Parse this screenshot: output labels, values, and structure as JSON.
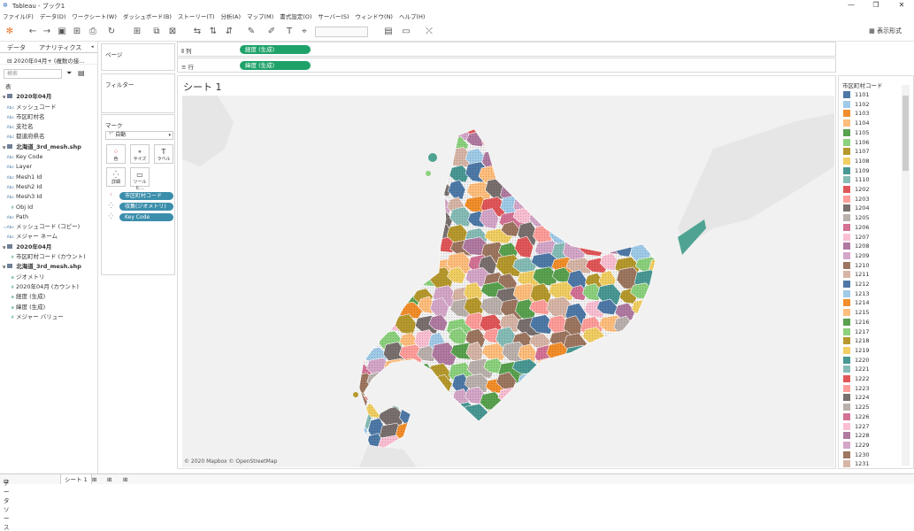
{
  "window": {
    "title": "Tableau - ブック1"
  },
  "menu": [
    "ファイル(F)",
    "データ(D)",
    "ワークシート(W)",
    "ダッシュボード(B)",
    "ストーリー(T)",
    "分析(A)",
    "マップ(M)",
    "書式設定(O)",
    "サーバー(S)",
    "ウィンドウ(N)",
    "ヘルプ(H)"
  ],
  "toolbar": {
    "show_me": "表示形式"
  },
  "datapane": {
    "tab_data": "データ",
    "tab_analytics": "アナリティクス",
    "source": "2020年04月+ (複数の接...",
    "search_placeholder": "検索",
    "section_table": "表",
    "fields": [
      {
        "type": "hdr",
        "name": "2020年04月"
      },
      {
        "type": "Abc",
        "name": "メッシュコード"
      },
      {
        "type": "Abc",
        "name": "市区町村名"
      },
      {
        "type": "Abc",
        "name": "支社名"
      },
      {
        "type": "Abc",
        "name": "都道府県名"
      },
      {
        "type": "hdr",
        "name": "北海道_3rd_mesh.shp"
      },
      {
        "type": "Abc",
        "name": "Key Code"
      },
      {
        "type": "Abc",
        "name": "Layer"
      },
      {
        "type": "Abc",
        "name": "Mesh1 Id"
      },
      {
        "type": "Abc",
        "name": "Mesh2 Id"
      },
      {
        "type": "Abc",
        "name": "Mesh3 Id"
      },
      {
        "type": "#",
        "name": "Obj Id"
      },
      {
        "type": "Abc",
        "name": "Path"
      },
      {
        "type": "=Abc",
        "name": "メッシュコード (コピー)"
      },
      {
        "type": "Abc",
        "name": "メジャー ネーム"
      },
      {
        "type": "hdr",
        "name": "2020年04月"
      },
      {
        "type": "#",
        "name": "市区町村コード (カウント)"
      },
      {
        "type": "hdr",
        "name": "北海道_3rd_mesh.shp"
      },
      {
        "type": "geo",
        "name": "ジオメトリ"
      },
      {
        "type": "#",
        "name": "2020年04月 (カウント)"
      },
      {
        "type": "geo",
        "name": "経度 (生成)"
      },
      {
        "type": "geo",
        "name": "緯度 (生成)"
      },
      {
        "type": "#",
        "name": "メジャー バリュー"
      }
    ]
  },
  "shelves": {
    "pages": "ページ",
    "filters": "フィルター",
    "marks": "マーク",
    "mark_type": "自動",
    "buttons": {
      "color": "色",
      "size": "サイズ",
      "label": "ラベル",
      "detail": "詳細",
      "tooltip": "ツールヒ..."
    },
    "mark_pills": [
      "市区町村コード",
      "収集(ジオメトリ)",
      "Key Code"
    ],
    "columns_label": "列",
    "rows_label": "行",
    "columns_pill": "経度 (生成)",
    "rows_pill": "緯度 (生成)"
  },
  "view": {
    "sheet_title": "シート 1",
    "credits": "© 2020 Mapbox © OpenStreetMap"
  },
  "legend": {
    "title": "市区町村コード",
    "items": [
      {
        "label": "1101",
        "color": "#4e79a7"
      },
      {
        "label": "1102",
        "color": "#a0cbe8"
      },
      {
        "label": "1103",
        "color": "#f28e2b"
      },
      {
        "label": "1104",
        "color": "#ffbe7d"
      },
      {
        "label": "1105",
        "color": "#59a14f"
      },
      {
        "label": "1106",
        "color": "#8cd17d"
      },
      {
        "label": "1107",
        "color": "#b6992d"
      },
      {
        "label": "1108",
        "color": "#f1ce63"
      },
      {
        "label": "1109",
        "color": "#499894"
      },
      {
        "label": "1110",
        "color": "#86bcb6"
      },
      {
        "label": "1202",
        "color": "#e15759"
      },
      {
        "label": "1203",
        "color": "#ff9d9a"
      },
      {
        "label": "1204",
        "color": "#79706e"
      },
      {
        "label": "1205",
        "color": "#bab0ac"
      },
      {
        "label": "1206",
        "color": "#d37295"
      },
      {
        "label": "1207",
        "color": "#fabfd2"
      },
      {
        "label": "1208",
        "color": "#b07aa1"
      },
      {
        "label": "1209",
        "color": "#d4a6c8"
      },
      {
        "label": "1210",
        "color": "#9d7660"
      },
      {
        "label": "1211",
        "color": "#d7b5a6"
      },
      {
        "label": "1212",
        "color": "#4e79a7"
      },
      {
        "label": "1213",
        "color": "#a0cbe8"
      },
      {
        "label": "1214",
        "color": "#f28e2b"
      },
      {
        "label": "1215",
        "color": "#ffbe7d"
      },
      {
        "label": "1216",
        "color": "#59a14f"
      },
      {
        "label": "1217",
        "color": "#8cd17d"
      },
      {
        "label": "1218",
        "color": "#b6992d"
      },
      {
        "label": "1219",
        "color": "#f1ce63"
      },
      {
        "label": "1220",
        "color": "#499894"
      },
      {
        "label": "1221",
        "color": "#86bcb6"
      },
      {
        "label": "1222",
        "color": "#e15759"
      },
      {
        "label": "1223",
        "color": "#ff9d9a"
      },
      {
        "label": "1224",
        "color": "#79706e"
      },
      {
        "label": "1225",
        "color": "#bab0ac"
      },
      {
        "label": "1226",
        "color": "#d37295"
      },
      {
        "label": "1227",
        "color": "#fabfd2"
      },
      {
        "label": "1228",
        "color": "#b07aa1"
      },
      {
        "label": "1229",
        "color": "#d4a6c8"
      },
      {
        "label": "1230",
        "color": "#9d7660"
      },
      {
        "label": "1231",
        "color": "#d7b5a6"
      }
    ]
  },
  "bottom_tabs": {
    "datasource": "データ ソース",
    "sheet": "シート 1"
  }
}
